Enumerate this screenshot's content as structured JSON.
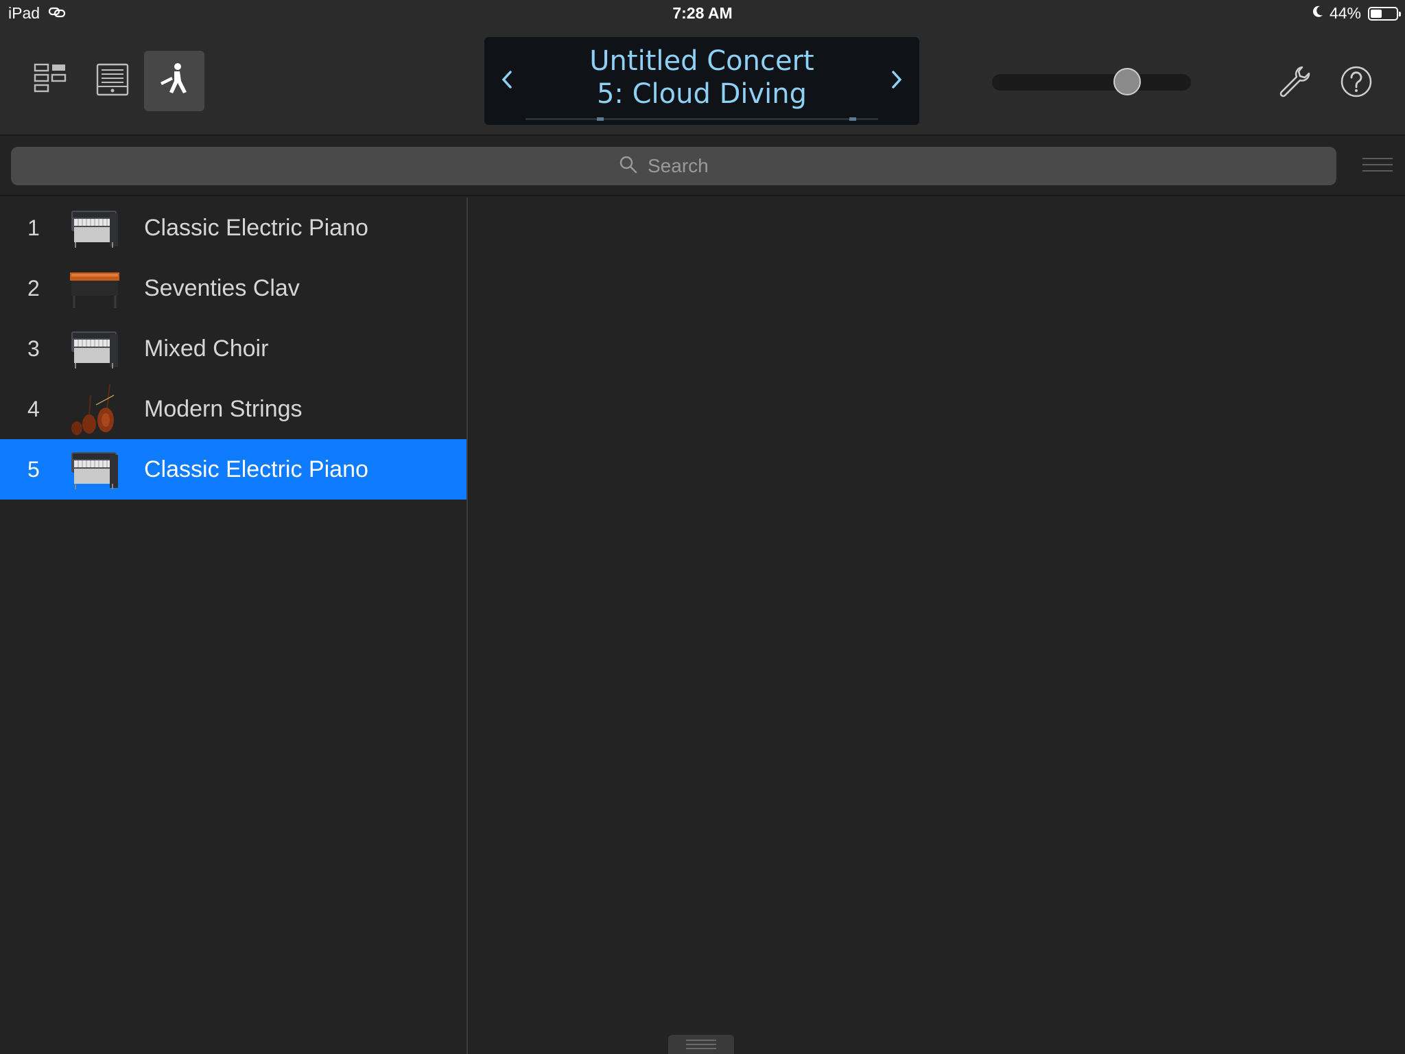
{
  "status_bar": {
    "device": "iPad",
    "time": "7:28 AM",
    "battery": "44%",
    "battery_level": 0.44
  },
  "toolbar": {
    "buttons": [
      {
        "name": "browser-view-icon",
        "active": false
      },
      {
        "name": "tracks-view-icon",
        "active": false
      },
      {
        "name": "perform-view-icon",
        "active": true
      }
    ],
    "lcd": {
      "concert": "Untitled Concert",
      "patch": "5: Cloud Diving"
    },
    "volume_level": 0.68,
    "color_lcd_text": "#8fd0f5",
    "color_accent": "#0f7bff"
  },
  "search": {
    "placeholder": "Search",
    "value": ""
  },
  "patches": [
    {
      "number": "1",
      "name": "Classic Electric Piano",
      "icon": "electric-piano-icon",
      "selected": false
    },
    {
      "number": "2",
      "name": "Seventies Clav",
      "icon": "clav-icon",
      "selected": false
    },
    {
      "number": "3",
      "name": "Mixed Choir",
      "icon": "electric-piano-icon",
      "selected": false
    },
    {
      "number": "4",
      "name": "Modern Strings",
      "icon": "strings-icon",
      "selected": false
    },
    {
      "number": "5",
      "name": "Classic Electric Piano",
      "icon": "electric-piano-icon",
      "selected": true
    }
  ]
}
